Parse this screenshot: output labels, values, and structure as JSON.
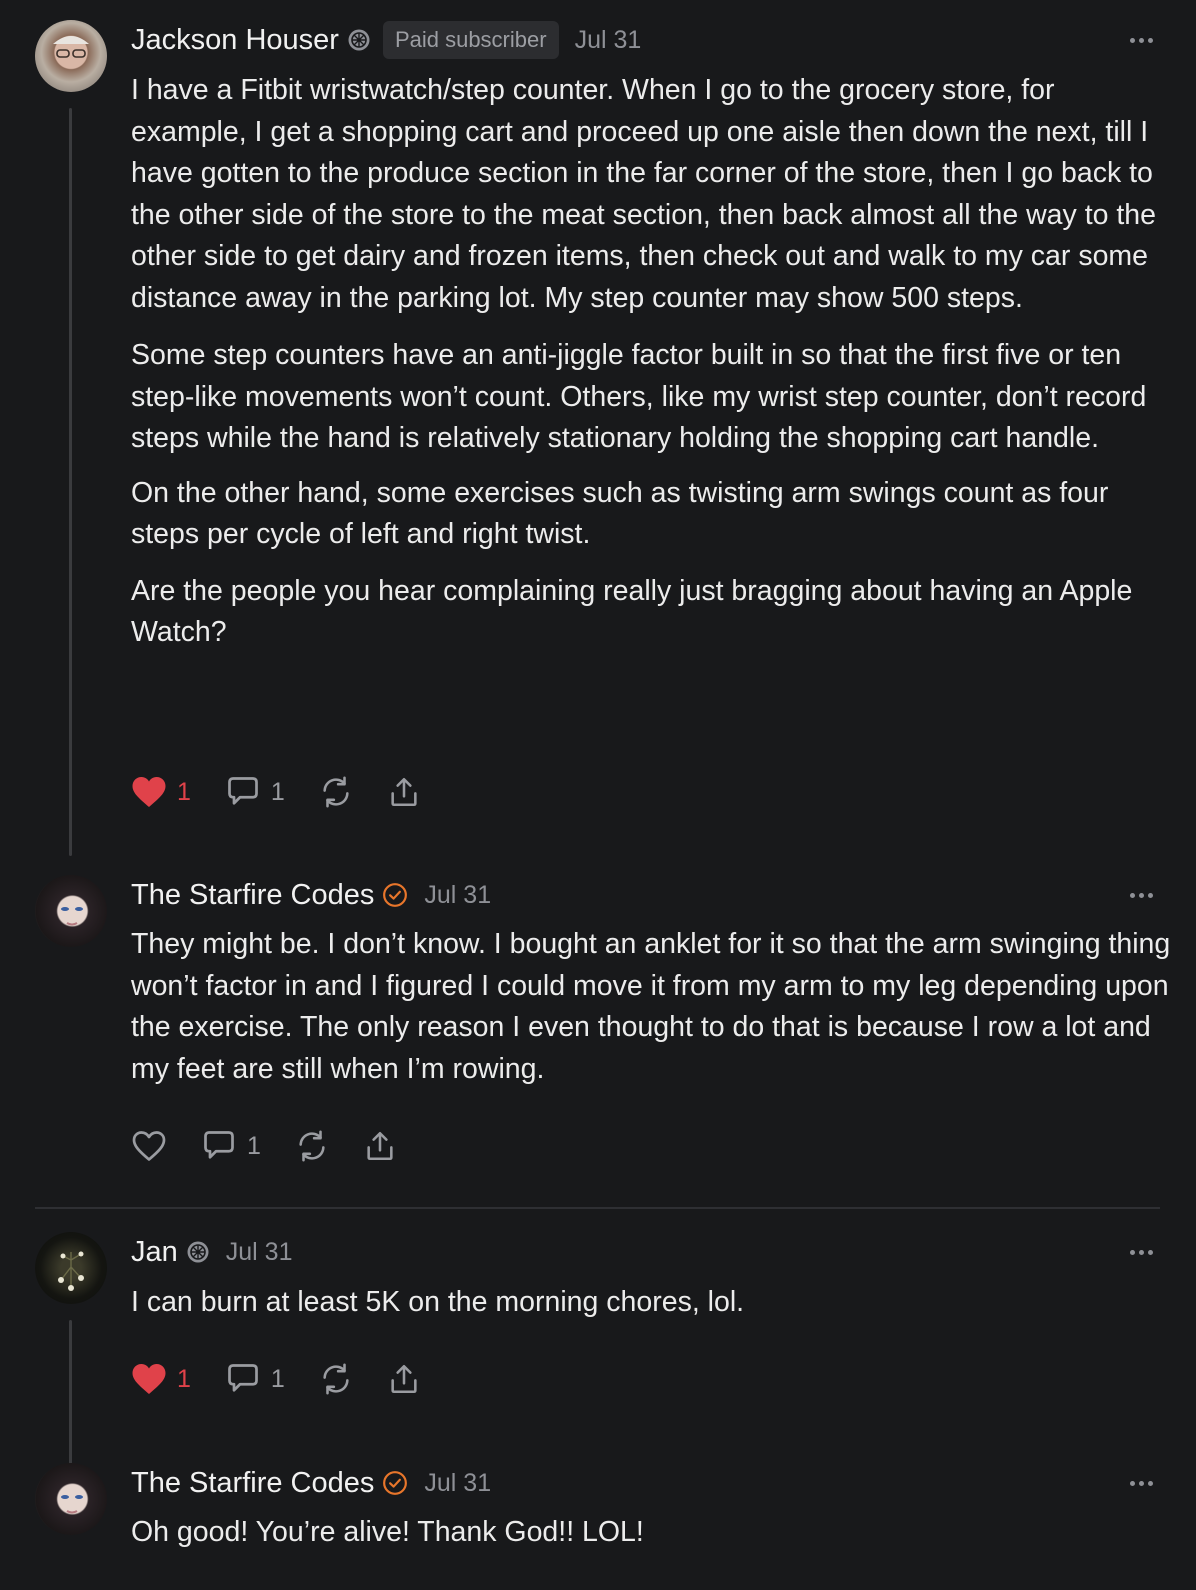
{
  "comments": [
    {
      "author": "Jackson Houser",
      "badge": "Paid subscriber",
      "date": "Jul 31",
      "paragraphs": [
        "I have a Fitbit wristwatch/step counter. When I go to the grocery store, for example, I get a shopping cart and proceed up one aisle then down the next, till I have gotten to the produce section in the far corner of the store, then I go back to the other side of the store to the meat section, then back almost all the way to the other side to get dairy and frozen items, then check out and walk to my car some distance away in the parking lot. My step counter may show 500 steps.",
        "Some step counters have an anti-jiggle factor built in so that the first five or ten step-like movements won’t count. Others, like my wrist step counter, don’t record steps while the hand is relatively stationary holding the shopping cart handle.",
        "On the other hand, some exercises such as twisting arm swings count as four steps per cycle of left and right twist.",
        "Are the people you hear complaining really just bragging about having an Apple Watch?"
      ],
      "likes": "1",
      "replies": "1"
    },
    {
      "author": "The Starfire Codes",
      "date": "Jul 31",
      "paragraphs": [
        "They might be. I don’t know. I bought an anklet for it so that the arm swinging thing won’t factor in and I figured I could move it from my arm to my leg depending upon the exercise. The only reason I even thought to do that is because I row a lot and my feet are still when I’m rowing."
      ],
      "replies": "1"
    },
    {
      "author": "Jan",
      "date": "Jul 31",
      "paragraphs": [
        "I can burn at least 5K on the morning chores, lol."
      ],
      "likes": "1",
      "replies": "1"
    },
    {
      "author": "The Starfire Codes",
      "date": "Jul 31",
      "paragraphs": [
        "Oh good! You’re alive! Thank God!! LOL!"
      ]
    }
  ],
  "colors": {
    "background": "#18191b",
    "like": "#e0424a",
    "verified": "#e8762b",
    "muted": "#8e9096"
  }
}
